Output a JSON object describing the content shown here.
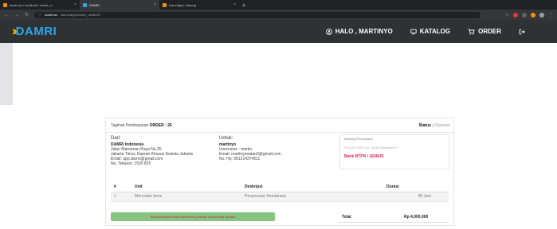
{
  "browser": {
    "tabs": [
      {
        "title": "localhost / localhost / damri_u...",
        "active": false,
        "favicon_color": "#f29100"
      },
      {
        "title": "DAMRI",
        "active": true,
        "favicon_color": "#2aa5e8"
      },
      {
        "title": "Damritiga | Katalog",
        "active": false,
        "favicon_color": "#f29100"
      }
    ],
    "url": {
      "host": "localhost",
      "path": "/damri/app/invoice_detail/25"
    }
  },
  "navbar": {
    "brand_text": "DAMRI",
    "greeting": "HALO , MARTINYO",
    "catalog_label": "KATALOG",
    "order_label": "ORDER"
  },
  "invoice": {
    "title_prefix": "Tagihan Pembayaran",
    "order_label": "ORDER : 25",
    "status_label": "Status :",
    "status_value": "Diproses",
    "from": {
      "heading": "Dari:",
      "name": "DAMRI Indonesia",
      "address_line1": "Jalan Matraman Raya No.25",
      "address_line2": "Jakarta Timur, Daerah Khusus Ibukota Jakarta",
      "email": "Email: app.damri@gmail.com",
      "phone": "No. Telepon: 1500 825"
    },
    "to": {
      "heading": "Untuk:",
      "name": "martinyo",
      "username": "Username : martin",
      "email": "Email: martinyonatan9@gmail.com",
      "phone": "No. Hp: 081214374511"
    },
    "payment": {
      "caption": "Rekening Pembayaran",
      "account": "90014227392 a.n. Teuku Mahendra P",
      "bank": "Bank BTPN / JENIUS"
    },
    "table": {
      "headers": [
        "#",
        "Unit",
        "Deskripsi",
        "Durasi"
      ],
      "rows": [
        {
          "no": "1",
          "unit": "Mercedes benz",
          "description": "Penyewaan Kendaraan",
          "duration": "48 Jam"
        }
      ]
    },
    "alert_text": "Bukti pembayaran telah kami terima, pesanan anda sedang diproses",
    "total_label": "Total",
    "total_value": "Rp 4,000,000"
  }
}
